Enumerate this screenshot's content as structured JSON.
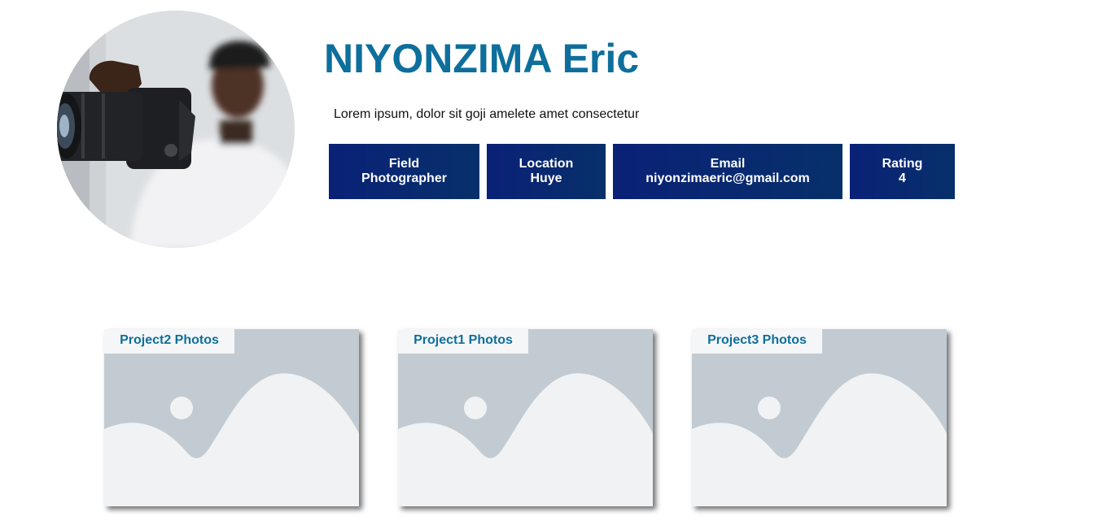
{
  "profile": {
    "name": "NIYONZIMA Eric",
    "bio": "Lorem ipsum, dolor sit goji amelete amet consectetur",
    "avatar_icon": "photographer-with-camera-photo"
  },
  "info": [
    {
      "label": "Field",
      "value": "Photographer"
    },
    {
      "label": "Location",
      "value": "Huye"
    },
    {
      "label": "Email",
      "value": "niyonzimaeric@gmail.com"
    },
    {
      "label": "Rating",
      "value": "4"
    }
  ],
  "projects": [
    {
      "title": "Project2 Photos",
      "icon": "image-placeholder-icon"
    },
    {
      "title": "Project1 Photos",
      "icon": "image-placeholder-icon"
    },
    {
      "title": "Project3 Photos",
      "icon": "image-placeholder-icon"
    }
  ],
  "colors": {
    "name": "#0e6f9c",
    "info_box_start": "#0a2177",
    "info_box_end": "#07306a",
    "placeholder_bg": "#c3cbd2",
    "placeholder_fg": "#f1f2f3"
  }
}
